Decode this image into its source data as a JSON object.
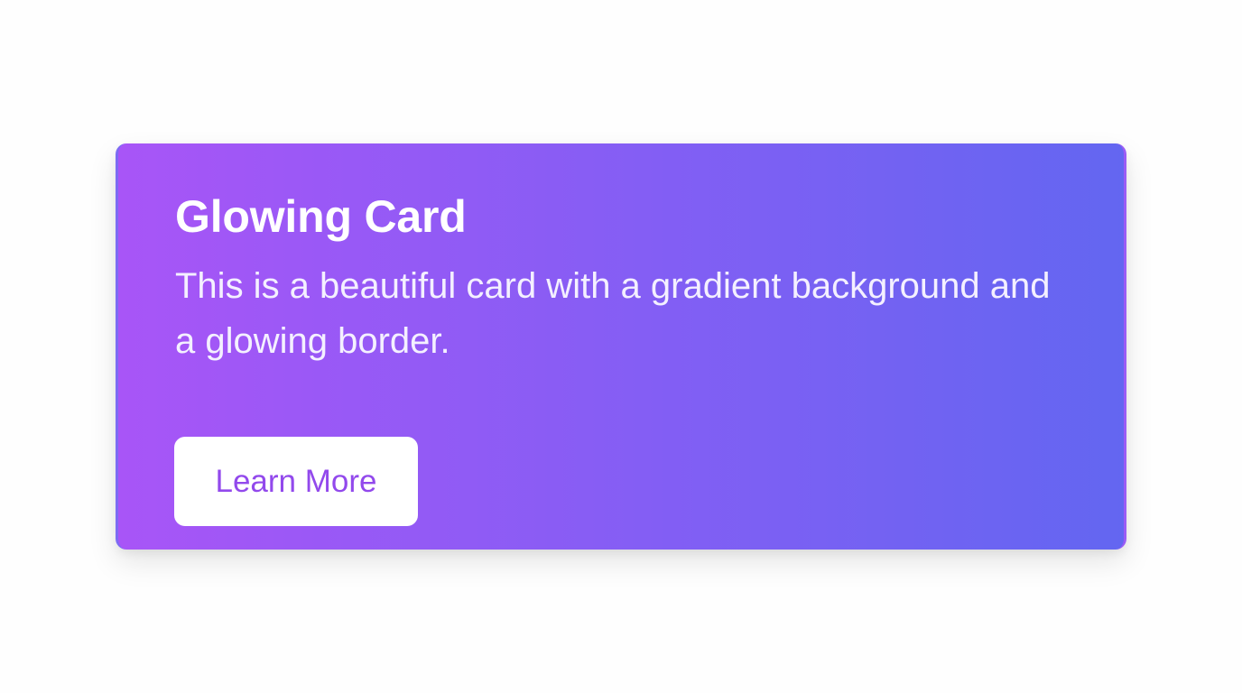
{
  "card": {
    "title": "Glowing Card",
    "description": "This is a beautiful card with a gradient background and a glowing border.",
    "button_label": "Learn More"
  },
  "colors": {
    "gradient_start": "#a855f7",
    "gradient_end": "#6366f1",
    "button_text": "#9249ec",
    "button_background": "#ffffff",
    "page_background": "#ffffff"
  }
}
